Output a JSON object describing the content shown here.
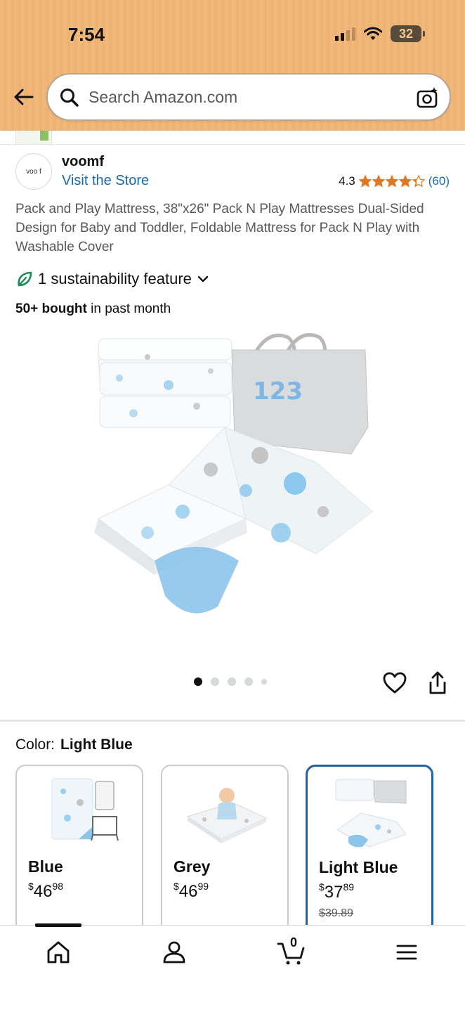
{
  "status_bar": {
    "time": "7:54",
    "battery": "32"
  },
  "search": {
    "placeholder": "Search Amazon.com"
  },
  "brand": {
    "logo_text": "voo f",
    "name": "voomf",
    "visit_store": "Visit the Store",
    "rating": "4.3",
    "rating_stars": 4.3,
    "rating_count": "(60)"
  },
  "product": {
    "title": "Pack and Play Mattress, 38\"x26\" Pack N Play Mattresses Dual-Sided Design for Baby and Toddler, Foldable Mattress for Pack N Play with Washable Cover",
    "sustainability": "1 sustainability feature",
    "bought_bold": "50+ bought",
    "bought_rest": " in past month",
    "image_text": "123",
    "image_count": 5,
    "active_image": 0
  },
  "color": {
    "label": "Color:",
    "selected": "Light Blue",
    "options": [
      {
        "name": "Blue",
        "price_whole": "46",
        "price_frac": "98",
        "currency": "$",
        "list_price": ""
      },
      {
        "name": "Grey",
        "price_whole": "46",
        "price_frac": "99",
        "currency": "$",
        "list_price": ""
      },
      {
        "name": "Light Blue",
        "price_whole": "37",
        "price_frac": "89",
        "currency": "$",
        "list_price": "$39.89"
      }
    ]
  },
  "nav": {
    "items": [
      "home-icon",
      "account-icon",
      "cart-icon",
      "menu-icon"
    ],
    "cart_count": "0"
  },
  "colors": {
    "accent_blue": "#2162a1",
    "link": "#1b6aa5",
    "star": "#de7921",
    "header_bg": "#f1b87a"
  }
}
